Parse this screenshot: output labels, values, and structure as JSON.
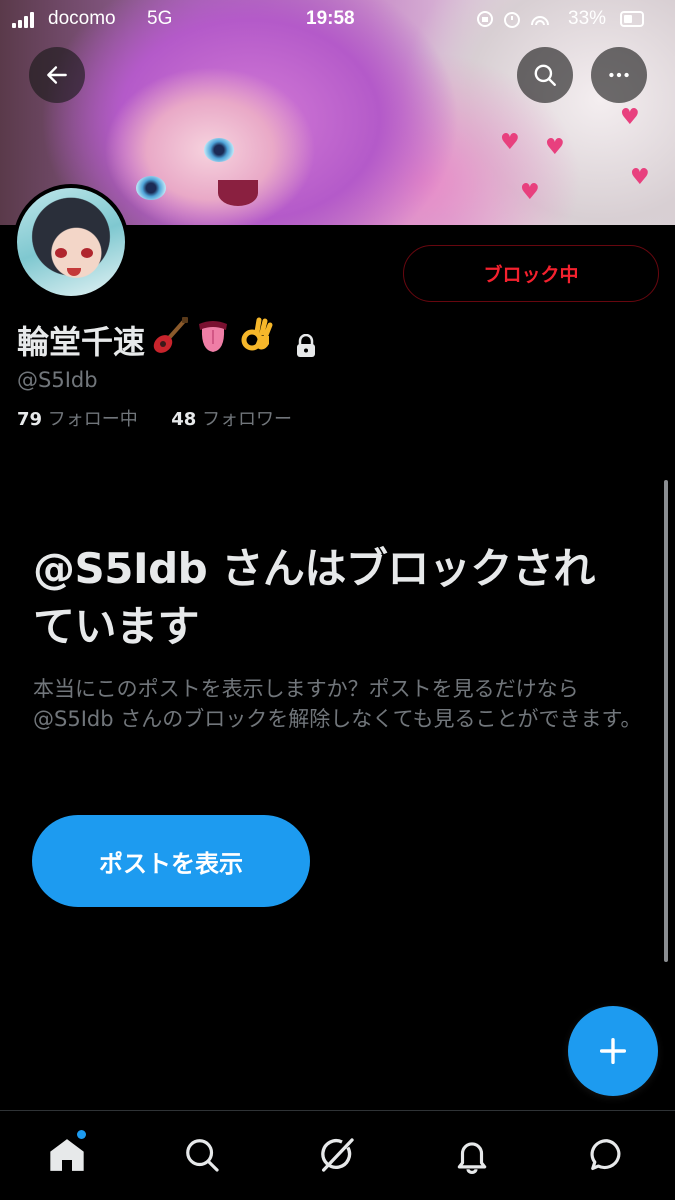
{
  "status_bar": {
    "carrier": "docomo",
    "network": "5G",
    "time": "19:58",
    "battery_percent": "33%"
  },
  "header": {
    "icons": [
      "back-arrow-icon",
      "search-icon",
      "more-icon"
    ]
  },
  "profile": {
    "display_name": "輪堂千速",
    "display_name_emojis": [
      "guitar-emoji",
      "tongue-emoji",
      "ok-hand-emoji"
    ],
    "protected": true,
    "handle": "@S5Idb",
    "following_count": "79",
    "following_label": "フォロー中",
    "followers_count": "48",
    "followers_label": "フォロワー",
    "block_button_label": "ブロック中"
  },
  "blocked_notice": {
    "title": "@S5Idb さんはブロックされています",
    "description": "本当にこのポストを表示しますか？ポストを見るだけなら @S5Idb さんのブロックを解除しなくても見ることができます。",
    "show_posts_button": "ポストを表示"
  },
  "fab": {
    "icon": "plus-icon"
  },
  "bottom_nav": {
    "items": [
      "home-icon",
      "search-icon",
      "grok-icon",
      "notifications-icon",
      "messages-icon"
    ],
    "active": "home-icon"
  },
  "colors": {
    "accent": "#1d9bf0",
    "block_red": "#f4212e",
    "muted_text": "#71767b",
    "background": "#000000"
  }
}
